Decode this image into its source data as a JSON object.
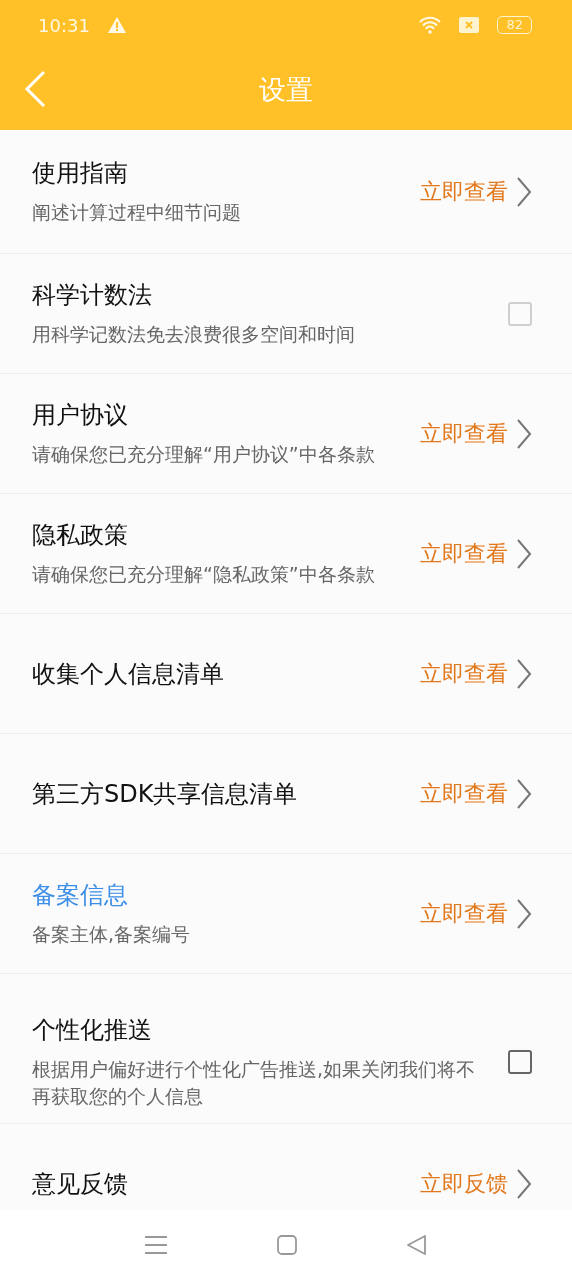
{
  "status_bar": {
    "time": "10:31",
    "battery": "82"
  },
  "header": {
    "title": "设置"
  },
  "sections": [
    [
      {
        "kind": "link",
        "title": "使用指南",
        "subtitle": "阐述计算过程中细节问题",
        "action": "立即查看",
        "accent": false
      },
      {
        "kind": "check",
        "title": "科学计数法",
        "subtitle": "用科学记数法免去浪费很多空间和时间",
        "checked": false,
        "disabled": true,
        "accent": false
      },
      {
        "kind": "link",
        "title": "用户协议",
        "subtitle": "请确保您已充分理解“用户协议”中各条款",
        "action": "立即查看",
        "accent": false
      },
      {
        "kind": "link",
        "title": "隐私政策",
        "subtitle": "请确保您已充分理解“隐私政策”中各条款",
        "action": "立即查看",
        "accent": false
      },
      {
        "kind": "link",
        "title": "收集个人信息清单",
        "action": "立即查看",
        "accent": false
      },
      {
        "kind": "link",
        "title": "第三方SDK共享信息清单",
        "action": "立即查看",
        "accent": false
      },
      {
        "kind": "link",
        "title": "备案信息",
        "subtitle": "备案主体,备案编号",
        "action": "立即查看",
        "accent": true
      }
    ],
    [
      {
        "kind": "check",
        "title": "个性化推送",
        "subtitle": "根据用户偏好进行个性化广告推送,如果关闭我们将不再获取您的个人信息",
        "checked": false,
        "disabled": false,
        "accent": false
      },
      {
        "kind": "link",
        "title": "意见反馈",
        "action": "立即反馈",
        "accent": false
      }
    ]
  ]
}
